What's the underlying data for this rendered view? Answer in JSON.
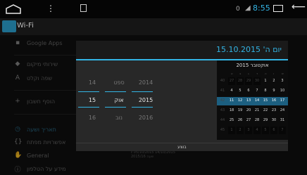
{
  "status": {
    "time": "8:55",
    "wifi": "0",
    "signal": "◢"
  },
  "actionbar": {
    "title": "Wi-Fi"
  },
  "sidebar": {
    "items": [
      {
        "label": "Google Apps",
        "icon": "▪"
      },
      {
        "label": "שירותי מיקום",
        "icon": "◆"
      },
      {
        "label": "שפה וקלט",
        "icon": "A"
      },
      {
        "label": "הוסף חשבון",
        "icon": "+"
      },
      {
        "label": "תאריך ושעה",
        "icon": "◷"
      },
      {
        "label": "אפשרויות מפתח",
        "icon": "{}"
      },
      {
        "label": "General",
        "icon": "✋"
      },
      {
        "label": "מידע על הטלפון",
        "icon": "ⓘ"
      }
    ]
  },
  "background": {
    "line1": "ℓ 05/10/2015 14/10/2015",
    "line2": "שעה 2015/16"
  },
  "dialog": {
    "title": "15.10.2015 'יום ה",
    "spinner": {
      "day": [
        "14",
        "15",
        "16"
      ],
      "month": [
        "ספט",
        "אוק",
        "נוב"
      ],
      "year": [
        "2014",
        "2015",
        "2016"
      ]
    },
    "calendar": {
      "header": "אוקטובר 2015",
      "weekdays": [
        "א",
        "ב",
        "ג",
        "ד",
        "ה",
        "ו",
        "ש"
      ],
      "weeks": [
        {
          "num": "40",
          "days": [
            "27",
            "28",
            "29",
            "30",
            "1",
            "2",
            "3"
          ],
          "muted": 4
        },
        {
          "num": "41",
          "days": [
            "4",
            "5",
            "6",
            "7",
            "8",
            "9",
            "10"
          ],
          "muted": 0
        },
        {
          "num": "42",
          "days": [
            "11",
            "12",
            "13",
            "14",
            "15",
            "16",
            "17"
          ],
          "muted": 0,
          "selected": true
        },
        {
          "num": "43",
          "days": [
            "18",
            "19",
            "20",
            "21",
            "22",
            "23",
            "24"
          ],
          "muted": 0
        },
        {
          "num": "44",
          "days": [
            "25",
            "26",
            "27",
            "28",
            "29",
            "30",
            "31"
          ],
          "muted": 0
        },
        {
          "num": "45",
          "days": [
            "1",
            "2",
            "3",
            "4",
            "5",
            "6",
            "7"
          ],
          "muted": 7
        }
      ]
    },
    "button": "בוצע"
  }
}
